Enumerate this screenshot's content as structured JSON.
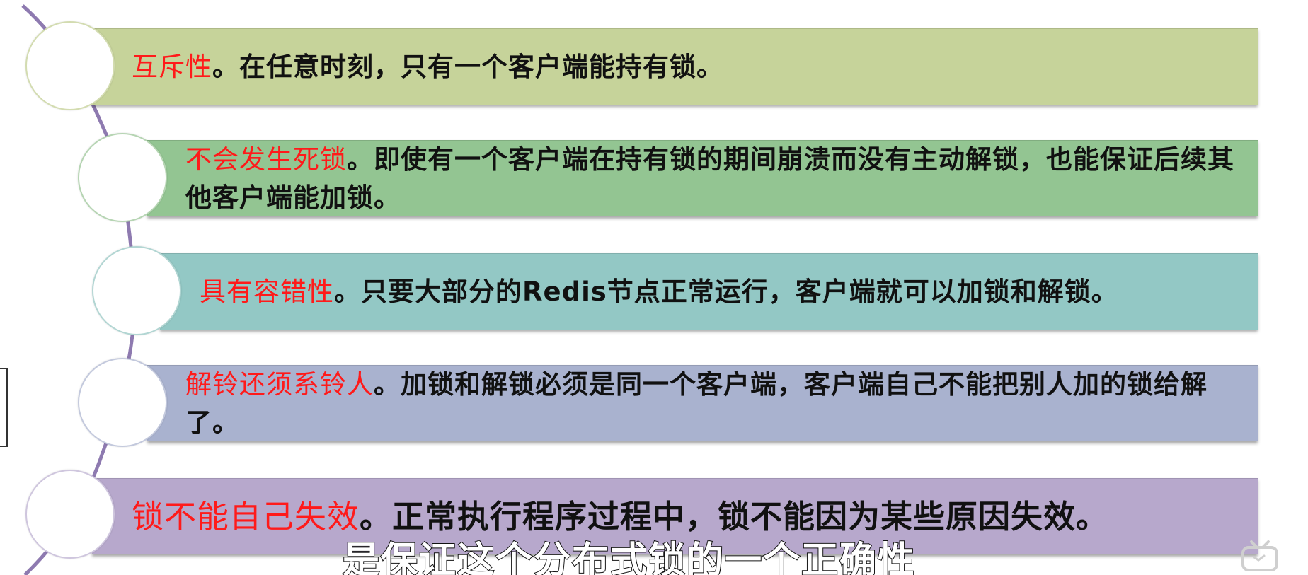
{
  "items": [
    {
      "key": "互斥性",
      "text": "。在任意时刻，只有一个客户端能持有锁。",
      "color": "#c6d39a"
    },
    {
      "key": "不会发生死锁",
      "text": "。即使有一个客户端在持有锁的期间崩溃而没有主动解锁，也能保证后续其他客户端能加锁。",
      "color": "#93c592"
    },
    {
      "key": "具有容错性",
      "text": "。只要大部分的Redis节点正常运行，客户端就可以加锁和解锁。",
      "color": "#93c8c5"
    },
    {
      "key": "解铃还须系铃人",
      "text": "。加锁和解锁必须是同一个客户端，客户端自己不能把别人加的锁给解了。",
      "color": "#a9b2cf"
    },
    {
      "key": "锁不能自己失效",
      "text": "。正常执行程序过程中，锁不能因为某些原因失效。",
      "color": "#b7a8cc"
    }
  ],
  "subtitle": "是保证这个分布式锁的一个正确性",
  "spine_color": "#8e7ab0"
}
